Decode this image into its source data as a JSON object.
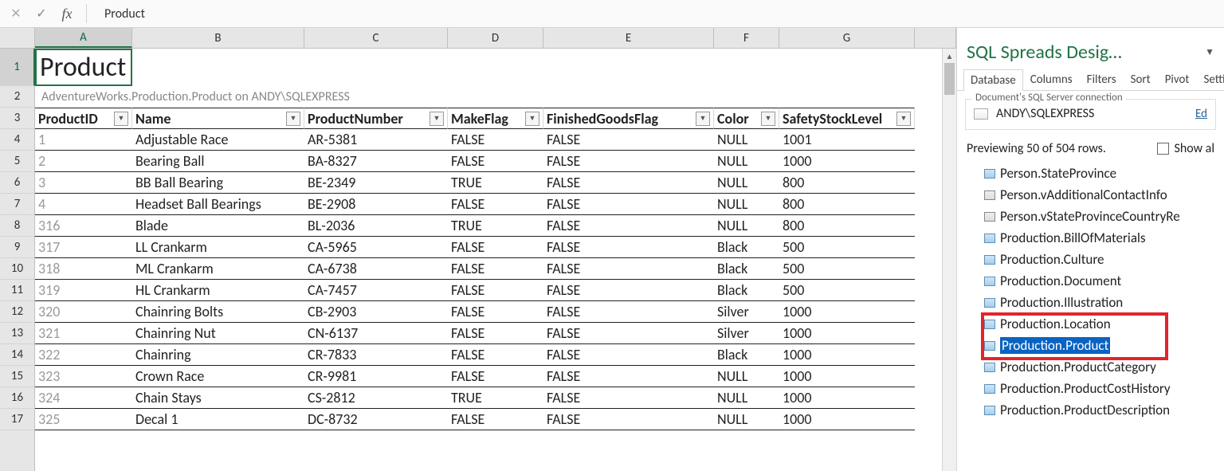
{
  "formula_bar": {
    "value": "Product"
  },
  "columns": [
    "A",
    "B",
    "C",
    "D",
    "E",
    "F",
    "G"
  ],
  "title": "Product",
  "subtitle": "AdventureWorks.Production.Product on ANDY\\SQLEXPRESS",
  "headers": [
    "ProductID",
    "Name",
    "ProductNumber",
    "MakeFlag",
    "FinishedGoodsFlag",
    "Color",
    "SafetyStockLevel"
  ],
  "rows": [
    {
      "n": 4,
      "id": "1",
      "name": "Adjustable Race",
      "pn": "AR-5381",
      "mf": "FALSE",
      "fg": "FALSE",
      "color": "NULL",
      "ssl": "1001"
    },
    {
      "n": 5,
      "id": "2",
      "name": "Bearing Ball",
      "pn": "BA-8327",
      "mf": "FALSE",
      "fg": "FALSE",
      "color": "NULL",
      "ssl": "1000"
    },
    {
      "n": 6,
      "id": "3",
      "name": "BB Ball Bearing",
      "pn": "BE-2349",
      "mf": "TRUE",
      "fg": "FALSE",
      "color": "NULL",
      "ssl": "800"
    },
    {
      "n": 7,
      "id": "4",
      "name": "Headset Ball Bearings",
      "pn": "BE-2908",
      "mf": "FALSE",
      "fg": "FALSE",
      "color": "NULL",
      "ssl": "800"
    },
    {
      "n": 8,
      "id": "316",
      "name": "Blade",
      "pn": "BL-2036",
      "mf": "TRUE",
      "fg": "FALSE",
      "color": "NULL",
      "ssl": "800"
    },
    {
      "n": 9,
      "id": "317",
      "name": "LL Crankarm",
      "pn": "CA-5965",
      "mf": "FALSE",
      "fg": "FALSE",
      "color": "Black",
      "ssl": "500"
    },
    {
      "n": 10,
      "id": "318",
      "name": "ML Crankarm",
      "pn": "CA-6738",
      "mf": "FALSE",
      "fg": "FALSE",
      "color": "Black",
      "ssl": "500"
    },
    {
      "n": 11,
      "id": "319",
      "name": "HL Crankarm",
      "pn": "CA-7457",
      "mf": "FALSE",
      "fg": "FALSE",
      "color": "Black",
      "ssl": "500"
    },
    {
      "n": 12,
      "id": "320",
      "name": "Chainring Bolts",
      "pn": "CB-2903",
      "mf": "FALSE",
      "fg": "FALSE",
      "color": "Silver",
      "ssl": "1000"
    },
    {
      "n": 13,
      "id": "321",
      "name": "Chainring Nut",
      "pn": "CN-6137",
      "mf": "FALSE",
      "fg": "FALSE",
      "color": "Silver",
      "ssl": "1000"
    },
    {
      "n": 14,
      "id": "322",
      "name": "Chainring",
      "pn": "CR-7833",
      "mf": "FALSE",
      "fg": "FALSE",
      "color": "Black",
      "ssl": "1000"
    },
    {
      "n": 15,
      "id": "323",
      "name": "Crown Race",
      "pn": "CR-9981",
      "mf": "FALSE",
      "fg": "FALSE",
      "color": "NULL",
      "ssl": "1000"
    },
    {
      "n": 16,
      "id": "324",
      "name": "Chain Stays",
      "pn": "CS-2812",
      "mf": "TRUE",
      "fg": "FALSE",
      "color": "NULL",
      "ssl": "1000"
    },
    {
      "n": 17,
      "id": "325",
      "name": "Decal 1",
      "pn": "DC-8732",
      "mf": "FALSE",
      "fg": "FALSE",
      "color": "NULL",
      "ssl": "1000"
    }
  ],
  "panel": {
    "title": "SQL Spreads Desig…",
    "tabs": [
      "Database",
      "Columns",
      "Filters",
      "Sort",
      "Pivot",
      "Setti"
    ],
    "active_tab": 0,
    "connection_label": "Document's SQL Server connection",
    "server": "ANDY\\SQLEXPRESS",
    "edit_link": "Ed",
    "preview_text": "Previewing 50 of 504 rows.",
    "show_all_label": "Show al",
    "tree": [
      {
        "label": "Person.StateProvince",
        "type": "table"
      },
      {
        "label": "Person.vAdditionalContactInfo",
        "type": "view"
      },
      {
        "label": "Person.vStateProvinceCountryRe",
        "type": "view"
      },
      {
        "label": "Production.BillOfMaterials",
        "type": "table"
      },
      {
        "label": "Production.Culture",
        "type": "table"
      },
      {
        "label": "Production.Document",
        "type": "table"
      },
      {
        "label": "Production.Illustration",
        "type": "table"
      },
      {
        "label": "Production.Location",
        "type": "table"
      },
      {
        "label": "Production.Product",
        "type": "table",
        "selected": true
      },
      {
        "label": "Production.ProductCategory",
        "type": "table"
      },
      {
        "label": "Production.ProductCostHistory",
        "type": "table"
      },
      {
        "label": "Production.ProductDescription",
        "type": "table"
      }
    ]
  }
}
